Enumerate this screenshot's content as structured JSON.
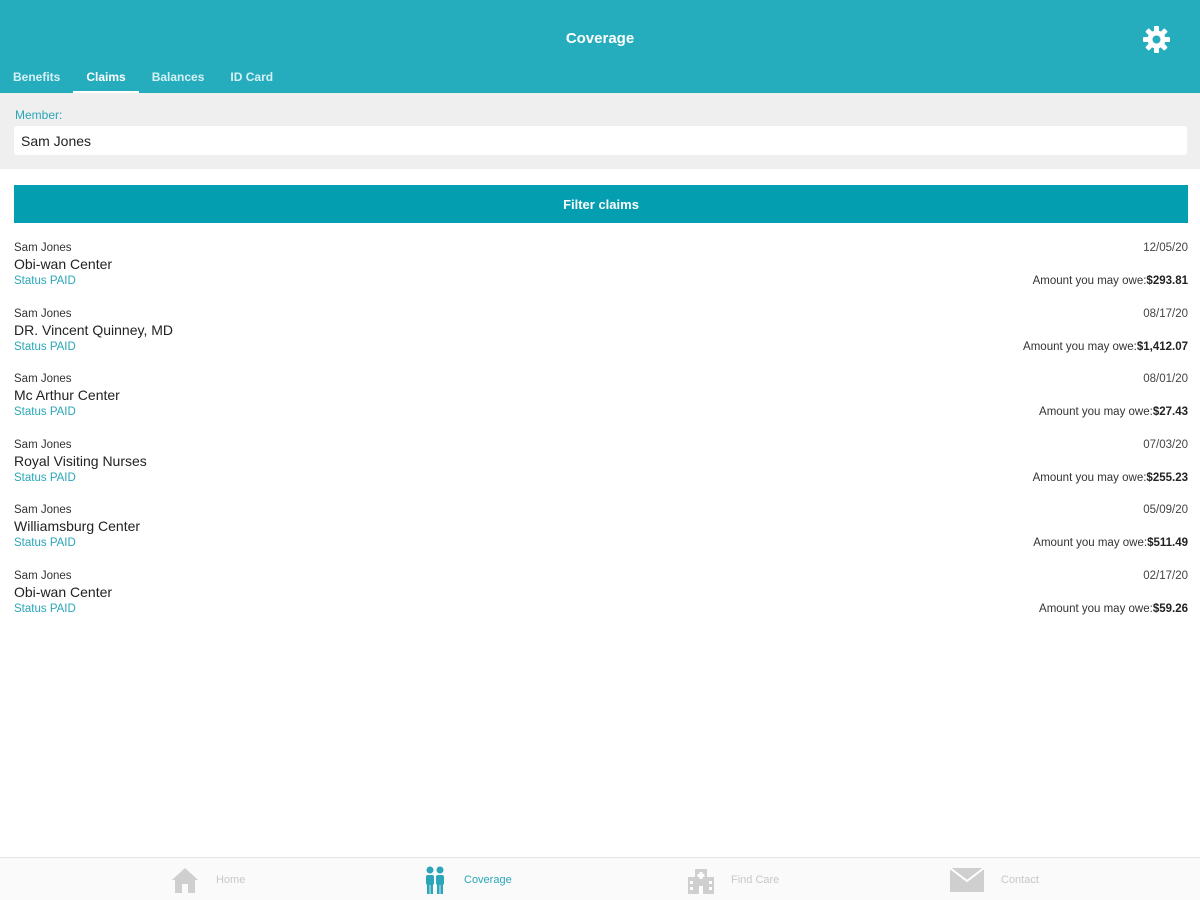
{
  "header": {
    "title": "Coverage",
    "settings_icon": "gear-icon"
  },
  "tabs": [
    {
      "label": "Benefits",
      "active": false
    },
    {
      "label": "Claims",
      "active": true
    },
    {
      "label": "Balances",
      "active": false
    },
    {
      "label": "ID Card",
      "active": false
    }
  ],
  "member": {
    "label": "Member:",
    "value": "Sam Jones"
  },
  "filter_button": {
    "label": "Filter claims"
  },
  "claims": [
    {
      "member": "Sam Jones",
      "provider": "Obi-wan Center",
      "status_label": "Status",
      "status": "PAID",
      "date": "12/05/20",
      "owe_label": "Amount you may owe:",
      "amount": "$293.81"
    },
    {
      "member": "Sam Jones",
      "provider": "DR. Vincent Quinney, MD",
      "status_label": "Status",
      "status": "PAID",
      "date": "08/17/20",
      "owe_label": "Amount you may owe:",
      "amount": "$1,412.07"
    },
    {
      "member": "Sam Jones",
      "provider": "Mc Arthur Center",
      "status_label": "Status",
      "status": "PAID",
      "date": "08/01/20",
      "owe_label": "Amount you may owe:",
      "amount": "$27.43"
    },
    {
      "member": "Sam Jones",
      "provider": "Royal Visiting Nurses",
      "status_label": "Status",
      "status": "PAID",
      "date": "07/03/20",
      "owe_label": "Amount you may owe:",
      "amount": "$255.23"
    },
    {
      "member": "Sam Jones",
      "provider": "Williamsburg Center",
      "status_label": "Status",
      "status": "PAID",
      "date": "05/09/20",
      "owe_label": "Amount you may owe:",
      "amount": "$511.49"
    },
    {
      "member": "Sam Jones",
      "provider": "Obi-wan Center",
      "status_label": "Status",
      "status": "PAID",
      "date": "02/17/20",
      "owe_label": "Amount you may owe:",
      "amount": "$59.26"
    }
  ],
  "bottom_nav": [
    {
      "label": "Home",
      "icon": "home-icon",
      "active": false
    },
    {
      "label": "Coverage",
      "icon": "people-icon",
      "active": true
    },
    {
      "label": "Find Care",
      "icon": "building-icon",
      "active": false
    },
    {
      "label": "Contact",
      "icon": "envelope-icon",
      "active": false
    }
  ],
  "colors": {
    "header_bg": "#25adbe",
    "button_bg": "#049eb1",
    "accent_text": "#2aa6b8",
    "inactive_nav": "#c8c8c8",
    "panel_bg": "#efefef"
  }
}
